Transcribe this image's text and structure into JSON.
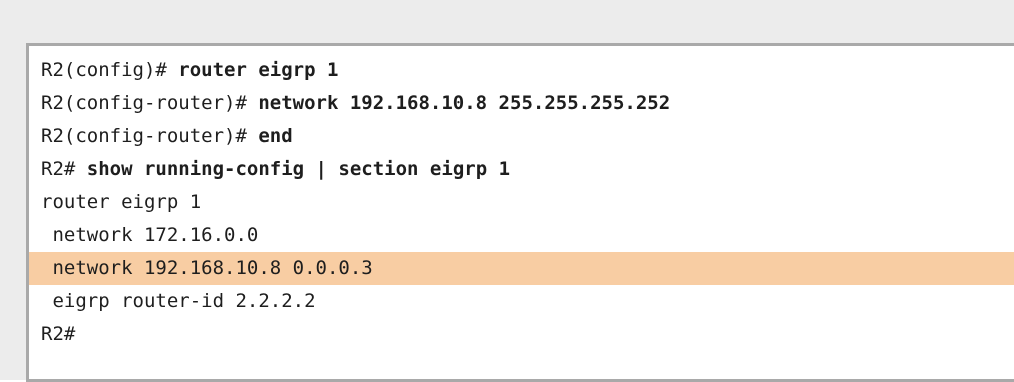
{
  "terminal": {
    "lines": [
      {
        "prompt": "R2(config)# ",
        "command": "router eigrp 1",
        "output": ""
      },
      {
        "prompt": "R2(config-router)# ",
        "command": "network 192.168.10.8 255.255.255.252",
        "output": ""
      },
      {
        "prompt": "R2(config-router)# ",
        "command": "end",
        "output": ""
      },
      {
        "prompt": "R2# ",
        "command": "show running-config | section eigrp 1",
        "output": ""
      },
      {
        "prompt": "",
        "command": "",
        "output": "router eigrp 1"
      },
      {
        "prompt": "",
        "command": "",
        "output": " network 172.16.0.0"
      },
      {
        "prompt": "",
        "command": "",
        "output": " network 192.168.10.8 0.0.0.3"
      },
      {
        "prompt": "",
        "command": "",
        "output": " eigrp router-id 2.2.2.2"
      },
      {
        "prompt": "R2#",
        "command": "",
        "output": ""
      }
    ],
    "highlight_color": "#f8cda3"
  }
}
